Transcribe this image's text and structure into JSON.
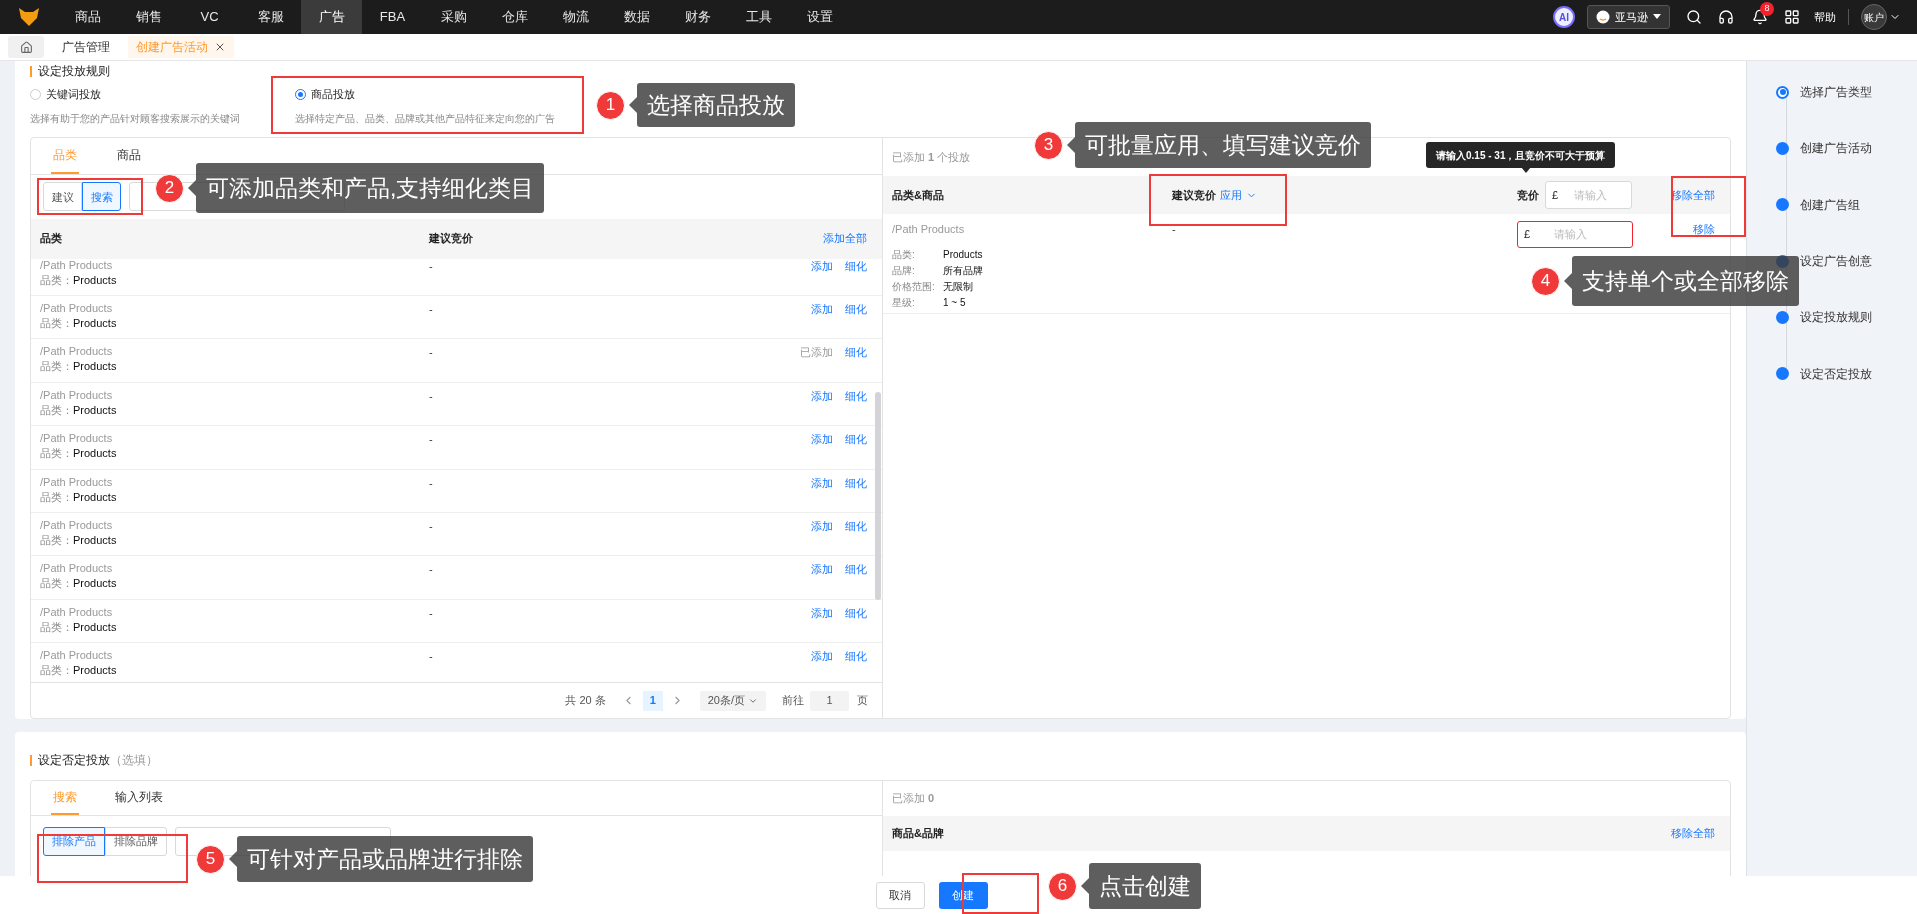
{
  "top_nav": {
    "items": [
      {
        "label": "商品",
        "selected": false
      },
      {
        "label": "销售",
        "selected": false
      },
      {
        "label": "VC",
        "selected": false
      },
      {
        "label": "客服",
        "selected": false
      },
      {
        "label": "广告",
        "selected": true
      },
      {
        "label": "FBA",
        "selected": false
      },
      {
        "label": "采购",
        "selected": false
      },
      {
        "label": "仓库",
        "selected": false
      },
      {
        "label": "物流",
        "selected": false
      },
      {
        "label": "数据",
        "selected": false
      },
      {
        "label": "财务",
        "selected": false
      },
      {
        "label": "工具",
        "selected": false
      },
      {
        "label": "设置",
        "selected": false
      }
    ],
    "ai_badge": "AI",
    "store_select": "亚马逊",
    "notification_count": "8",
    "help": "帮助",
    "account": "账户"
  },
  "page_tabs": [
    {
      "label": "广告管理",
      "selected": false,
      "closable": false
    },
    {
      "label": "创建广告活动",
      "selected": true,
      "closable": true
    }
  ],
  "targeting_rules": {
    "title": "设定投放规则",
    "options": [
      {
        "label": "关键词投放",
        "description": "选择有助于您的产品针对顾客搜索展示的关键词",
        "selected": false
      },
      {
        "label": "商品投放",
        "description": "选择特定产品、品类、品牌或其他产品特征来定向您的广告",
        "selected": true
      }
    ],
    "left_panel": {
      "tabs": [
        {
          "label": "品类",
          "selected": true
        },
        {
          "label": "商品",
          "selected": false
        }
      ],
      "mode_buttons": [
        {
          "label": "建议",
          "selected": false
        },
        {
          "label": "搜索",
          "selected": true
        }
      ],
      "columns": [
        "品类",
        "建议竞价"
      ],
      "add_all": "添加全部",
      "rows": [
        {
          "path": "/Path Products",
          "category_label": "品类：",
          "category": "Products",
          "suggested_bid": "-",
          "action": "添加",
          "added": false,
          "refine": "细化"
        },
        {
          "path": "/Path Products",
          "category_label": "品类：",
          "category": "Products",
          "suggested_bid": "-",
          "action": "添加",
          "added": false,
          "refine": "细化"
        },
        {
          "path": "/Path Products",
          "category_label": "品类：",
          "category": "Products",
          "suggested_bid": "-",
          "action": "已添加",
          "added": true,
          "refine": "细化"
        },
        {
          "path": "/Path Products",
          "category_label": "品类：",
          "category": "Products",
          "suggested_bid": "-",
          "action": "添加",
          "added": false,
          "refine": "细化"
        },
        {
          "path": "/Path Products",
          "category_label": "品类：",
          "category": "Products",
          "suggested_bid": "-",
          "action": "添加",
          "added": false,
          "refine": "细化"
        },
        {
          "path": "/Path Products",
          "category_label": "品类：",
          "category": "Products",
          "suggested_bid": "-",
          "action": "添加",
          "added": false,
          "refine": "细化"
        },
        {
          "path": "/Path Products",
          "category_label": "品类：",
          "category": "Products",
          "suggested_bid": "-",
          "action": "添加",
          "added": false,
          "refine": "细化"
        },
        {
          "path": "/Path Products",
          "category_label": "品类：",
          "category": "Products",
          "suggested_bid": "-",
          "action": "添加",
          "added": false,
          "refine": "细化"
        },
        {
          "path": "/Path Products",
          "category_label": "品类：",
          "category": "Products",
          "suggested_bid": "-",
          "action": "添加",
          "added": false,
          "refine": "细化"
        },
        {
          "path": "/Path Products",
          "category_label": "品类：",
          "category": "Products",
          "suggested_bid": "-",
          "action": "添加",
          "added": false,
          "refine": "细化"
        }
      ],
      "pagination": {
        "total": "共 20 条",
        "pages": [
          {
            "label": "1",
            "selected": true
          }
        ],
        "page_size": "20条/页",
        "goto_label": "前往",
        "goto_value": "1",
        "page_suffix": "页"
      }
    },
    "right_panel": {
      "added_summary": "已添加 **1** 个投放",
      "columns": [
        "品类&商品",
        "建议竞价"
      ],
      "apply": "应用",
      "bid_label": "竞价",
      "currency": "£",
      "bid_placeholder": "请输入",
      "remove_all": "移除全部",
      "tooltip": "请输入0.15 - 31，且竞价不可大于预算",
      "rows": [
        {
          "path": "/Path Products",
          "details": [
            {
              "label": "品类:",
              "value": "Products"
            },
            {
              "label": "品牌:",
              "value": "所有品牌"
            },
            {
              "label": "价格范围:",
              "value": "无限制"
            },
            {
              "label": "星级:",
              "value": "1 ~ 5"
            }
          ],
          "suggested_bid": "-",
          "currency": "£",
          "bid_placeholder": "请输入",
          "error": true,
          "remove": "移除"
        }
      ]
    }
  },
  "negative_targeting": {
    "title": "设定否定投放",
    "optional": "（选填）",
    "tabs": [
      {
        "label": "搜索",
        "selected": true
      },
      {
        "label": "输入列表",
        "selected": false
      }
    ],
    "mode_buttons": [
      {
        "label": "排除产品",
        "selected": true
      },
      {
        "label": "排除品牌",
        "selected": false
      }
    ],
    "added_summary": "已添加 **0**",
    "column": "商品&品牌",
    "remove_all": "移除全部"
  },
  "steps": [
    {
      "label": "选择广告类型",
      "current": true
    },
    {
      "label": "创建广告活动",
      "current": false
    },
    {
      "label": "创建广告组",
      "current": false
    },
    {
      "label": "设定广告创意",
      "current": false
    },
    {
      "label": "设定投放规则",
      "current": false
    },
    {
      "label": "设定否定投放",
      "current": false
    }
  ],
  "footer": {
    "cancel": "取消",
    "create": "创建"
  },
  "annotations": [
    {
      "number": "1",
      "text": "选择商品投放"
    },
    {
      "number": "2",
      "text": "可添加品类和产品,支持细化类目"
    },
    {
      "number": "3",
      "text": "可批量应用、填写建议竞价"
    },
    {
      "number": "4",
      "text": "支持单个或全部移除"
    },
    {
      "number": "5",
      "text": "可针对产品或品牌进行排除"
    },
    {
      "number": "6",
      "text": "点击创建"
    }
  ]
}
